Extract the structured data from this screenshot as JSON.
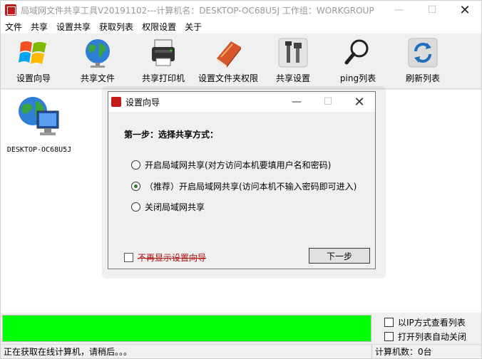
{
  "window": {
    "title": "局域网文件共享工具V20191102---计算机名：DESKTOP-OC68U5J  工作组：WORKGROUP",
    "minimize": "—",
    "maximize": "☐",
    "close": "✕"
  },
  "menu": [
    "文件",
    "共享",
    "设置共享",
    "获取列表",
    "权限设置",
    "关于"
  ],
  "toolbar": [
    {
      "label": "设置向导",
      "icon": "windows-logo-icon"
    },
    {
      "label": "共享文件",
      "icon": "globe-icon"
    },
    {
      "label": "共享打印机",
      "icon": "printer-icon"
    },
    {
      "label": "设置文件夹权限",
      "icon": "book-icon"
    },
    {
      "label": "共享设置",
      "icon": "tools-icon"
    },
    {
      "label": "ping列表",
      "icon": "magnifier-icon"
    },
    {
      "label": "刷新列表",
      "icon": "refresh-icon"
    }
  ],
  "computers": [
    {
      "name": "DESKTOP-OC68U5J",
      "icon": "network-computer-icon"
    }
  ],
  "dialog": {
    "title": "设置向导",
    "minimize": "—",
    "maximize": "☐",
    "close": "✕",
    "step": "第一步：选择共享方式：",
    "options": [
      {
        "label": "开启局域网共享(对方访问本机要填用户名和密码)",
        "selected": false
      },
      {
        "label": "（推荐）开启局域网共享(访问本机不输入密码即可进入)",
        "selected": true
      },
      {
        "label": "关闭局域网共享",
        "selected": false
      }
    ],
    "dont_show": "不再显示设置向导",
    "next": "下一步"
  },
  "progress": {
    "value": 1.0,
    "color": "#00ff00"
  },
  "options": {
    "ip_view": "以IP方式查看列表",
    "auto_close": "打开列表自动关闭"
  },
  "status": {
    "message": "正在获取在线计算机，请稍后。。。",
    "count": "计算机数：0台"
  }
}
